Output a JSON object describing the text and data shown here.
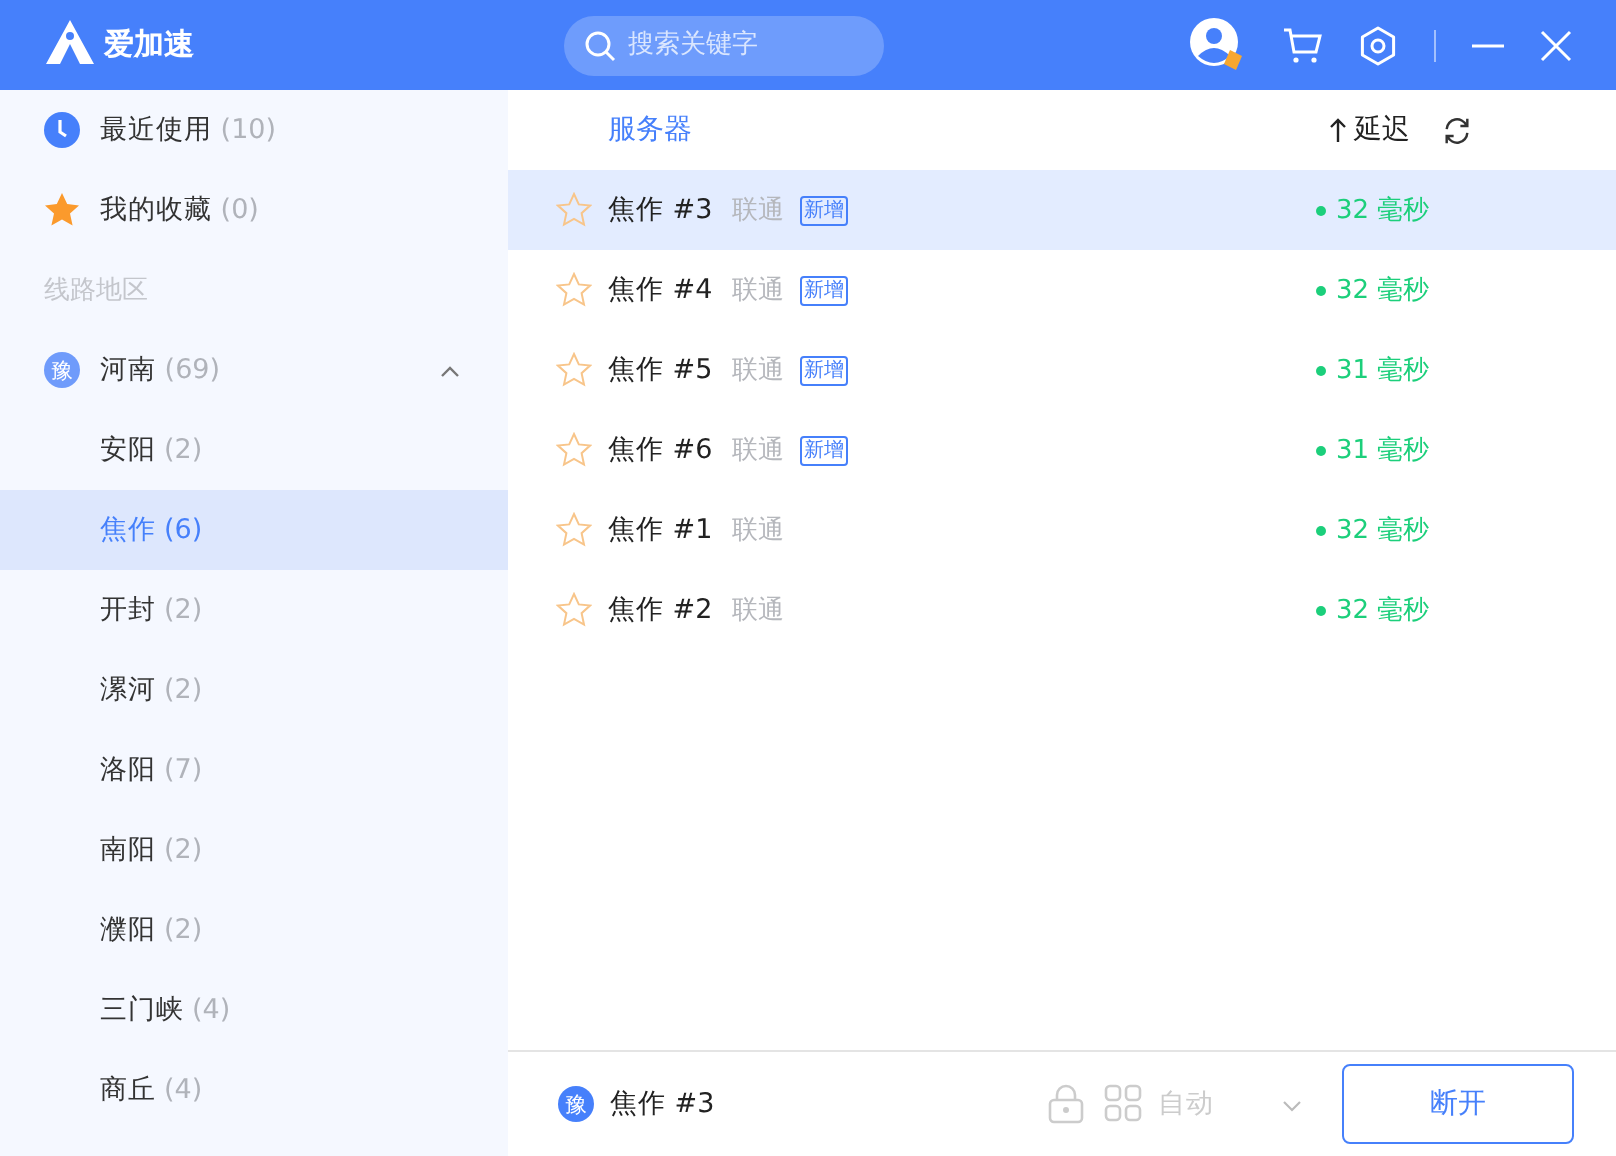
{
  "titlebar": {
    "app_name": "爱加速",
    "search": {
      "placeholder": "搜索关键字"
    }
  },
  "sidebar": {
    "shortcuts": [
      {
        "kind": "recent",
        "label": "最近使用",
        "count": "(10)"
      },
      {
        "kind": "favorites",
        "label": "我的收藏",
        "count": "(0)"
      }
    ],
    "section_label": "线路地区",
    "regions": [
      {
        "badge": "豫",
        "label": "河南",
        "count": "(69)",
        "expanded": true,
        "children": [
          {
            "label": "安阳",
            "count": "(2)",
            "selected": false
          },
          {
            "label": "焦作",
            "count": "(6)",
            "selected": true
          },
          {
            "label": "开封",
            "count": "(2)",
            "selected": false
          },
          {
            "label": "漯河",
            "count": "(2)",
            "selected": false
          },
          {
            "label": "洛阳",
            "count": "(7)",
            "selected": false
          },
          {
            "label": "南阳",
            "count": "(2)",
            "selected": false
          },
          {
            "label": "濮阳",
            "count": "(2)",
            "selected": false
          },
          {
            "label": "三门峡",
            "count": "(4)",
            "selected": false
          },
          {
            "label": "商丘",
            "count": "(4)",
            "selected": false
          }
        ]
      }
    ]
  },
  "server_list": {
    "columns": {
      "server": "服务器",
      "latency": "延迟"
    },
    "rows": [
      {
        "name": "焦作 #3",
        "isp": "联通",
        "tag": "新增",
        "latency": "32 毫秒",
        "selected": true,
        "favorite": false
      },
      {
        "name": "焦作 #4",
        "isp": "联通",
        "tag": "新增",
        "latency": "32 毫秒",
        "selected": false,
        "favorite": false
      },
      {
        "name": "焦作 #5",
        "isp": "联通",
        "tag": "新增",
        "latency": "31 毫秒",
        "selected": false,
        "favorite": false
      },
      {
        "name": "焦作 #6",
        "isp": "联通",
        "tag": "新增",
        "latency": "31 毫秒",
        "selected": false,
        "favorite": false
      },
      {
        "name": "焦作 #1",
        "isp": "联通",
        "latency": "32 毫秒",
        "selected": false,
        "favorite": false
      },
      {
        "name": "焦作 #2",
        "isp": "联通",
        "latency": "32 毫秒",
        "selected": false,
        "favorite": false
      }
    ]
  },
  "footer": {
    "region_badge": "豫",
    "server": "焦作 #3",
    "mode": "自动",
    "button": "断开"
  }
}
